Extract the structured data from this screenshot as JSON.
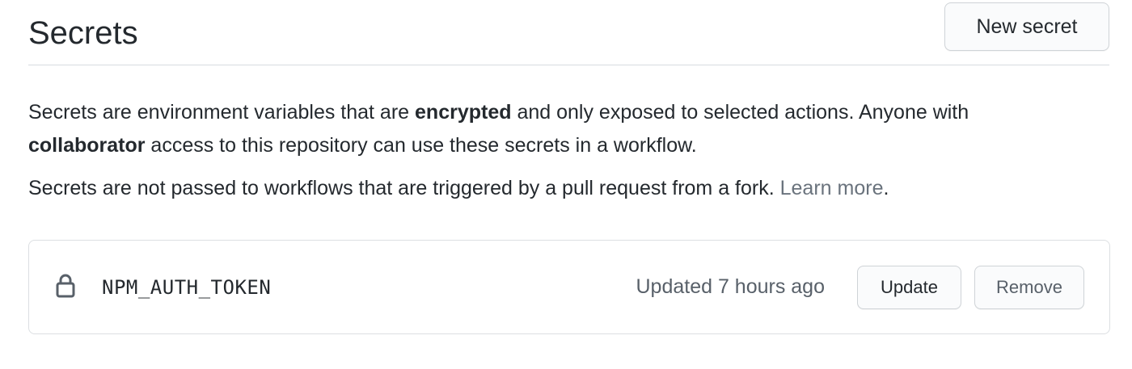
{
  "header": {
    "title": "Secrets",
    "new_secret_label": "New secret"
  },
  "description": {
    "part1": "Secrets are environment variables that are ",
    "bold1": "encrypted",
    "part2": " and only exposed to selected actions. Anyone with ",
    "bold2": "collaborator",
    "part3": " access to this repository can use these secrets in a workflow."
  },
  "note": {
    "text": "Secrets are not passed to workflows that are triggered by a pull request from a fork. ",
    "link_label": "Learn more",
    "suffix": "."
  },
  "secrets": [
    {
      "icon": "lock-icon",
      "name": "NPM_AUTH_TOKEN",
      "updated": "Updated 7 hours ago",
      "update_label": "Update",
      "remove_label": "Remove"
    }
  ],
  "colors": {
    "text": "#24292e",
    "muted": "#586069",
    "link": "#6a737d",
    "border": "#dcdfe2"
  }
}
